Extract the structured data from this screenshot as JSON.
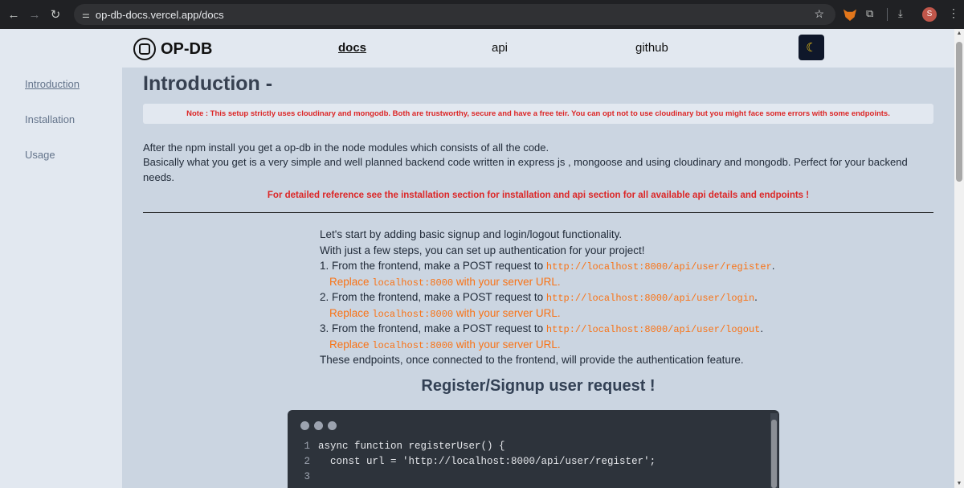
{
  "browser": {
    "url": "op-db-docs.vercel.app/docs",
    "avatar_letter": "S"
  },
  "header": {
    "brand": "OP-DB",
    "nav": [
      "docs",
      "api",
      "github"
    ],
    "theme_icon": "moon-icon"
  },
  "sidebar": {
    "items": [
      "Introduction",
      "Installation",
      "Usage"
    ],
    "active": "Introduction"
  },
  "main": {
    "title": "Introduction -",
    "note": "Note : This setup strictly uses cloudinary and mongodb. Both are trustworthy, secure and have a free teir. You can opt not to use cloudinary but you might face some errors with some endpoints.",
    "para1": "After the npm install you get a op-db in the node modules which consists of all the code.",
    "para2": "Basically what you get is a very simple and well planned backend code written in express js , mongoose and using cloudinary and mongodb. Perfect for your backend needs.",
    "reference": "For detailed reference see the installation section for installation and api section for all available api details and endpoints !",
    "intro1": "Let's start by adding basic signup and login/logout functionality.",
    "intro2": "With just a few steps, you can set up authentication for your project!",
    "step_prefix": "From the frontend, make a POST request to",
    "steps": [
      {
        "num": "1.",
        "url": "http://localhost:8000/api/user/register"
      },
      {
        "num": "2.",
        "url": "http://localhost:8000/api/user/login"
      },
      {
        "num": "3.",
        "url": "http://localhost:8000/api/user/logout"
      }
    ],
    "replace_prefix": "Replace",
    "replace_code": "localhost:8000",
    "replace_suffix": "with your server URL.",
    "closing": "These endpoints, once connected to the frontend, will provide the authentication feature.",
    "section_heading": "Register/Signup user request !"
  },
  "code": {
    "lines": [
      {
        "n": "1",
        "text": "async function registerUser() {"
      },
      {
        "n": "2",
        "text": "  const url = 'http://localhost:8000/api/user/register';"
      },
      {
        "n": "3",
        "text": ""
      }
    ]
  }
}
